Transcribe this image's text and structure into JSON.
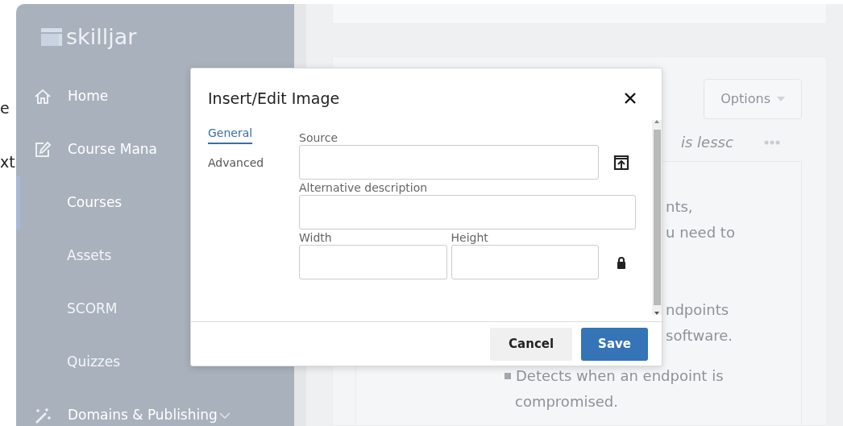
{
  "background_fragments": [
    "e",
    "xt"
  ],
  "sidebar": {
    "logo": "skilljar",
    "items": [
      {
        "label": "Home",
        "selected": false
      },
      {
        "label": "Course Mana",
        "selected": false,
        "expanded": true,
        "children": [
          {
            "label": "Courses",
            "selected": true
          },
          {
            "label": "Assets",
            "selected": false
          },
          {
            "label": "SCORM",
            "selected": false
          },
          {
            "label": "Quizzes",
            "selected": false
          }
        ]
      },
      {
        "label": "Domains & Publishing",
        "selected": false,
        "expanded": false
      }
    ]
  },
  "lesson_card": {
    "options_button": "Options",
    "italic_text": "is lessc",
    "content_lines": [
      {
        "kind": "fragment",
        "text": "nts,"
      },
      {
        "kind": "fragment",
        "text": "u need to"
      },
      {
        "kind": "gap"
      },
      {
        "kind": "fragment",
        "text": "ndpoints"
      },
      {
        "kind": "fragment",
        "text": "software."
      },
      {
        "kind": "bullet",
        "text": "Detects when an endpoint is"
      },
      {
        "kind": "continuation",
        "text": "compromised."
      }
    ]
  },
  "dialog": {
    "title": "Insert/Edit Image",
    "tabs": [
      {
        "label": "General",
        "selected": true
      },
      {
        "label": "Advanced",
        "selected": false
      }
    ],
    "field_rows": [
      {
        "kind": "browse",
        "fields": [
          {
            "label": "Source"
          }
        ]
      },
      {
        "kind": "plain",
        "fields": [
          {
            "label": "Alternative description"
          }
        ]
      },
      {
        "kind": "lock",
        "fields": [
          {
            "label": "Width"
          },
          {
            "label": "Height"
          }
        ]
      }
    ],
    "buttons": [
      {
        "label": "Cancel",
        "kind": "secondary"
      },
      {
        "label": "Save",
        "kind": "primary"
      }
    ]
  }
}
